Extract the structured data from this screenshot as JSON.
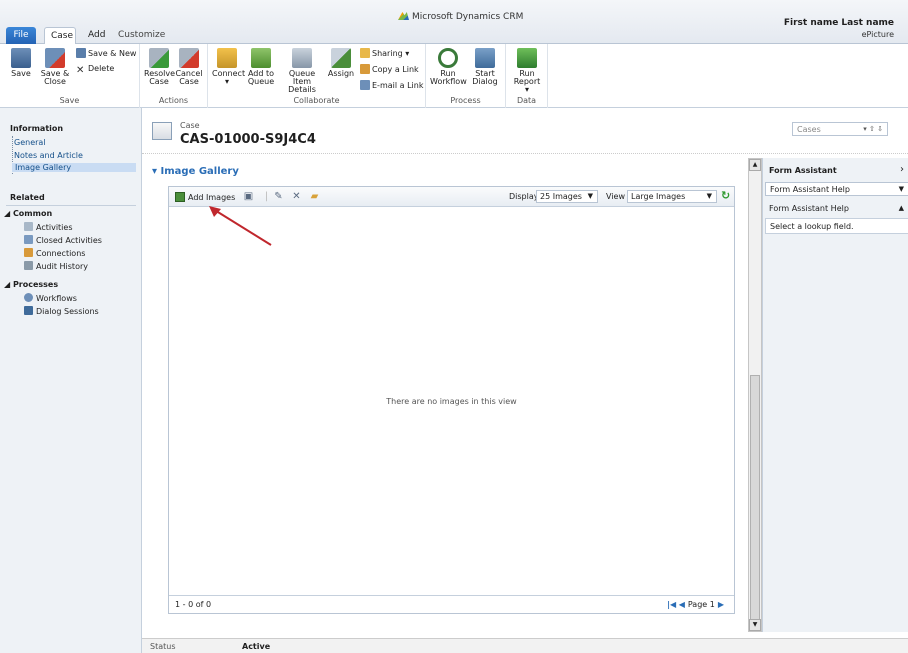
{
  "app": {
    "title": "Microsoft Dynamics CRM",
    "user_name": "First name Last name",
    "org_name": "ePicture"
  },
  "tabs": {
    "file": "File",
    "case": "Case",
    "add": "Add",
    "customize": "Customize"
  },
  "ribbon": {
    "save": {
      "save": "Save",
      "save_close_1": "Save &",
      "save_close_2": "Close",
      "save_new": "Save & New",
      "delete": "Delete",
      "group": "Save"
    },
    "actions": {
      "resolve_1": "Resolve",
      "resolve_2": "Case",
      "cancel_1": "Cancel",
      "cancel_2": "Case",
      "group": "Actions"
    },
    "collaborate": {
      "connect": "Connect",
      "add_queue_1": "Add to",
      "add_queue_2": "Queue",
      "queue_item_1": "Queue Item",
      "queue_item_2": "Details",
      "assign": "Assign",
      "sharing": "Sharing",
      "copy_link": "Copy a Link",
      "email_link": "E-mail a Link",
      "group": "Collaborate"
    },
    "process": {
      "run_workflow_1": "Run",
      "run_workflow_2": "Workflow",
      "start_dialog_1": "Start",
      "start_dialog_2": "Dialog",
      "group": "Process"
    },
    "data": {
      "run_report_1": "Run",
      "run_report_2": "Report",
      "group": "Data"
    }
  },
  "leftnav": {
    "information": "Information",
    "info_links": [
      "General",
      "Notes and Article",
      "Image Gallery"
    ],
    "related": "Related",
    "common": "Common",
    "common_items": [
      "Activities",
      "Closed Activities",
      "Connections",
      "Audit History"
    ],
    "processes": "Processes",
    "process_items": [
      "Workflows",
      "Dialog Sessions"
    ]
  },
  "header": {
    "entity_label": "Case",
    "record_id": "CAS-01000-S9J4C4",
    "entity_select": "Cases"
  },
  "gallery": {
    "title": "Image Gallery",
    "add_images": "Add Images",
    "display_label": "Display",
    "display_value": "25 Images",
    "view_label": "View",
    "view_value": "Large Images",
    "empty_message": "There are no images in this view",
    "record_count": "1 - 0 of 0",
    "page_label": "Page 1"
  },
  "assistant": {
    "title": "Form Assistant",
    "select_value": "Form Assistant Help",
    "help_head": "Form Assistant Help",
    "help_text": "Select a lookup field."
  },
  "status": {
    "label": "Status",
    "value": "Active"
  },
  "colors": {
    "accent": "#2a6db6",
    "annotation": "#c0272d"
  }
}
